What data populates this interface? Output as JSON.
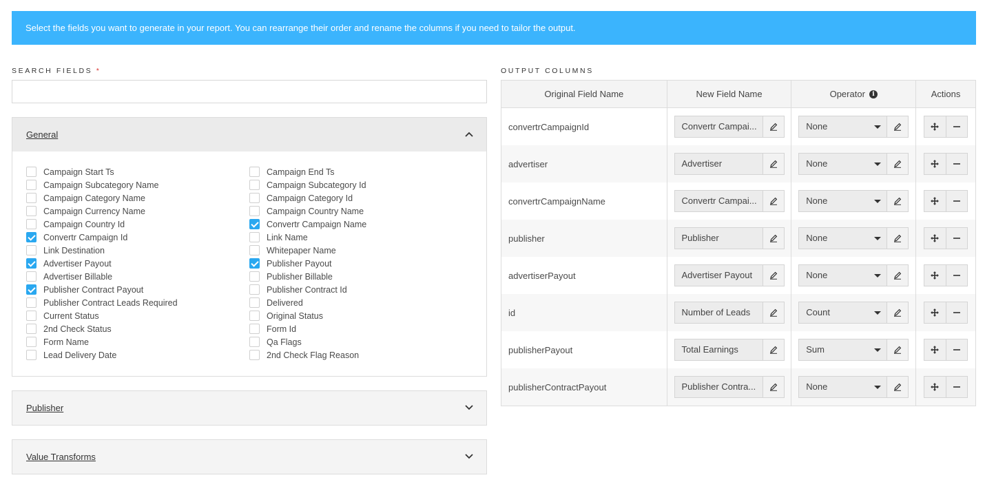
{
  "banner": {
    "text": "Select the fields you want to generate in your report. You can rearrange their order and rename the columns if you need to tailor the output."
  },
  "search": {
    "label": "SEARCH FIELDS",
    "required_mark": "*",
    "value": "",
    "placeholder": ""
  },
  "general": {
    "title": "General",
    "expanded": true,
    "left_fields": [
      {
        "label": "Campaign Start Ts",
        "checked": false
      },
      {
        "label": "Campaign Subcategory Name",
        "checked": false
      },
      {
        "label": "Campaign Category Name",
        "checked": false
      },
      {
        "label": "Campaign Currency Name",
        "checked": false
      },
      {
        "label": "Campaign Country Id",
        "checked": false
      },
      {
        "label": "Convertr Campaign Id",
        "checked": true
      },
      {
        "label": "Link Destination",
        "checked": false
      },
      {
        "label": "Advertiser Payout",
        "checked": true
      },
      {
        "label": "Advertiser Billable",
        "checked": false
      },
      {
        "label": "Publisher Contract Payout",
        "checked": true
      },
      {
        "label": "Publisher Contract Leads Required",
        "checked": false
      },
      {
        "label": "Current Status",
        "checked": false
      },
      {
        "label": "2nd Check Status",
        "checked": false
      },
      {
        "label": "Form Name",
        "checked": false
      },
      {
        "label": "Lead Delivery Date",
        "checked": false
      }
    ],
    "right_fields": [
      {
        "label": "Campaign End Ts",
        "checked": false
      },
      {
        "label": "Campaign Subcategory Id",
        "checked": false
      },
      {
        "label": "Campaign Category Id",
        "checked": false
      },
      {
        "label": "Campaign Country Name",
        "checked": false
      },
      {
        "label": "Convertr Campaign Name",
        "checked": true
      },
      {
        "label": "Link Name",
        "checked": false
      },
      {
        "label": "Whitepaper Name",
        "checked": false
      },
      {
        "label": "Publisher Payout",
        "checked": true
      },
      {
        "label": "Publisher Billable",
        "checked": false
      },
      {
        "label": "Publisher Contract Id",
        "checked": false
      },
      {
        "label": "Delivered",
        "checked": false
      },
      {
        "label": "Original Status",
        "checked": false
      },
      {
        "label": "Form Id",
        "checked": false
      },
      {
        "label": "Qa Flags",
        "checked": false
      },
      {
        "label": "2nd Check Flag Reason",
        "checked": false
      }
    ]
  },
  "publisher_section": {
    "title": "Publisher",
    "expanded": false
  },
  "value_transforms_section": {
    "title": "Value Transforms",
    "expanded": false
  },
  "output": {
    "label": "OUTPUT COLUMNS",
    "headers": {
      "original": "Original Field Name",
      "new_name": "New Field Name",
      "operator": "Operator",
      "actions": "Actions"
    },
    "rows": [
      {
        "original": "convertrCampaignId",
        "new_name": "Convertr Campai...",
        "operator": "None"
      },
      {
        "original": "advertiser",
        "new_name": "Advertiser",
        "operator": "None"
      },
      {
        "original": "convertrCampaignName",
        "new_name": "Convertr Campai...",
        "operator": "None"
      },
      {
        "original": "publisher",
        "new_name": "Publisher",
        "operator": "None"
      },
      {
        "original": "advertiserPayout",
        "new_name": "Advertiser Payout",
        "operator": "None"
      },
      {
        "original": "id",
        "new_name": "Number of Leads",
        "operator": "Count"
      },
      {
        "original": "publisherPayout",
        "new_name": "Total Earnings",
        "operator": "Sum"
      },
      {
        "original": "publisherContractPayout",
        "new_name": "Publisher Contra...",
        "operator": "None"
      }
    ]
  },
  "colors": {
    "banner": "#3bb4fd",
    "checkbox_checked": "#2aa8f0",
    "required": "#d9302c"
  },
  "icons": {
    "accordion_expanded": "chevron-up-icon",
    "accordion_collapsed": "chevron-down-icon",
    "edit": "pencil-icon",
    "operator_info": "info-icon",
    "add": "move-plus-icon",
    "remove": "minus-icon"
  }
}
